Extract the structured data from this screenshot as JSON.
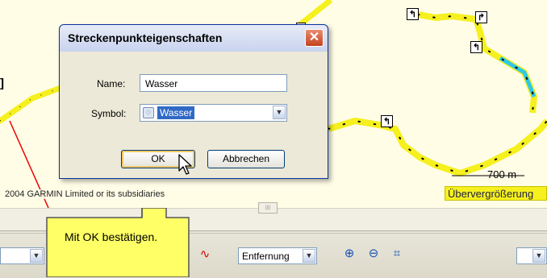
{
  "map": {
    "copyright": "2004 GARMIN Limited or its subsidiaries",
    "distance_label": "700 m",
    "scale_label": "Übervergrößerung",
    "left_bracket": "]"
  },
  "dialog": {
    "title": "Streckenpunkteigenschaften",
    "close_glyph": "✕",
    "name_label": "Name:",
    "name_value": "Wasser",
    "symbol_label": "Symbol:",
    "symbol_value": "Wasser",
    "ok_label": "OK",
    "cancel_label": "Abbrechen"
  },
  "toolbar": {
    "measure_select_value": "Entfernung",
    "icons": [
      "graph-icon",
      "zoom-in-icon",
      "zoom-out-icon",
      "zoom-fit-icon"
    ]
  },
  "callout": {
    "text": "Mit OK bestätigen."
  },
  "colors": {
    "route": "#f5f01e",
    "route_highlight": "#2fc8e8",
    "callout": "#ffff66",
    "dialog_border": "#0831a0"
  }
}
